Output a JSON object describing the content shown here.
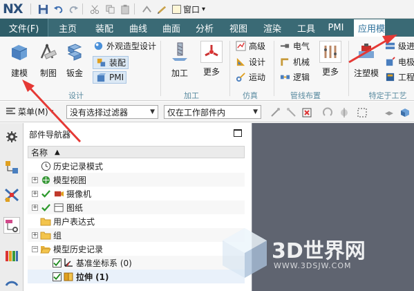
{
  "app": {
    "logo": "NX"
  },
  "titlebar": {
    "window_menu": "窗口",
    "window_menu_caret": "▾"
  },
  "tabs": [
    {
      "label": "文件(F)"
    },
    {
      "label": "主页"
    },
    {
      "label": "装配"
    },
    {
      "label": "曲线"
    },
    {
      "label": "曲面"
    },
    {
      "label": "分析"
    },
    {
      "label": "视图"
    },
    {
      "label": "渲染"
    },
    {
      "label": "工具"
    },
    {
      "label": "PMI"
    },
    {
      "label": "应用模"
    }
  ],
  "ribbon": {
    "design": {
      "label": "设计",
      "modeling": "建模",
      "drafting": "制图",
      "sheetmetal": "钣金",
      "shape_studio": "外观造型设计",
      "assemblies": "装配",
      "pmi": "PMI"
    },
    "machining": {
      "label": "加工",
      "cam": "加工",
      "more": "更多"
    },
    "simulation": {
      "label": "仿真",
      "advanced": "高级",
      "design": "设计",
      "motion": "运动"
    },
    "routing": {
      "label": "管线布置",
      "electrical": "电气",
      "mechanical": "机械",
      "logic": "逻辑",
      "more": "更多"
    },
    "process": {
      "label": "特定于工艺",
      "mold": "注塑模",
      "progressive": "级进",
      "electrode": "电极",
      "engineering": "工程"
    }
  },
  "toolbar2": {
    "menu": "菜单(M)",
    "selection_filter": "没有选择过滤器",
    "scope": "仅在工作部件内"
  },
  "navigator": {
    "title": "部件导航器",
    "column_name": "名称",
    "sort_indicator": "▲",
    "items": [
      {
        "label": "历史记录模式"
      },
      {
        "label": "模型视图"
      },
      {
        "label": "摄像机"
      },
      {
        "label": "图纸"
      },
      {
        "label": "用户表达式"
      },
      {
        "label": "组"
      },
      {
        "label": "模型历史记录"
      },
      {
        "label": "基准坐标系 (0)"
      },
      {
        "label": "拉伸 (1)"
      }
    ]
  },
  "watermark": {
    "title": "3D世界网",
    "url": "WWW.3DSJW.COM"
  },
  "colors": {
    "ribbon_tab_bg": "#3a6a75",
    "annotation_arrow": "#e53935",
    "graphics_bg": "#5f6470"
  }
}
